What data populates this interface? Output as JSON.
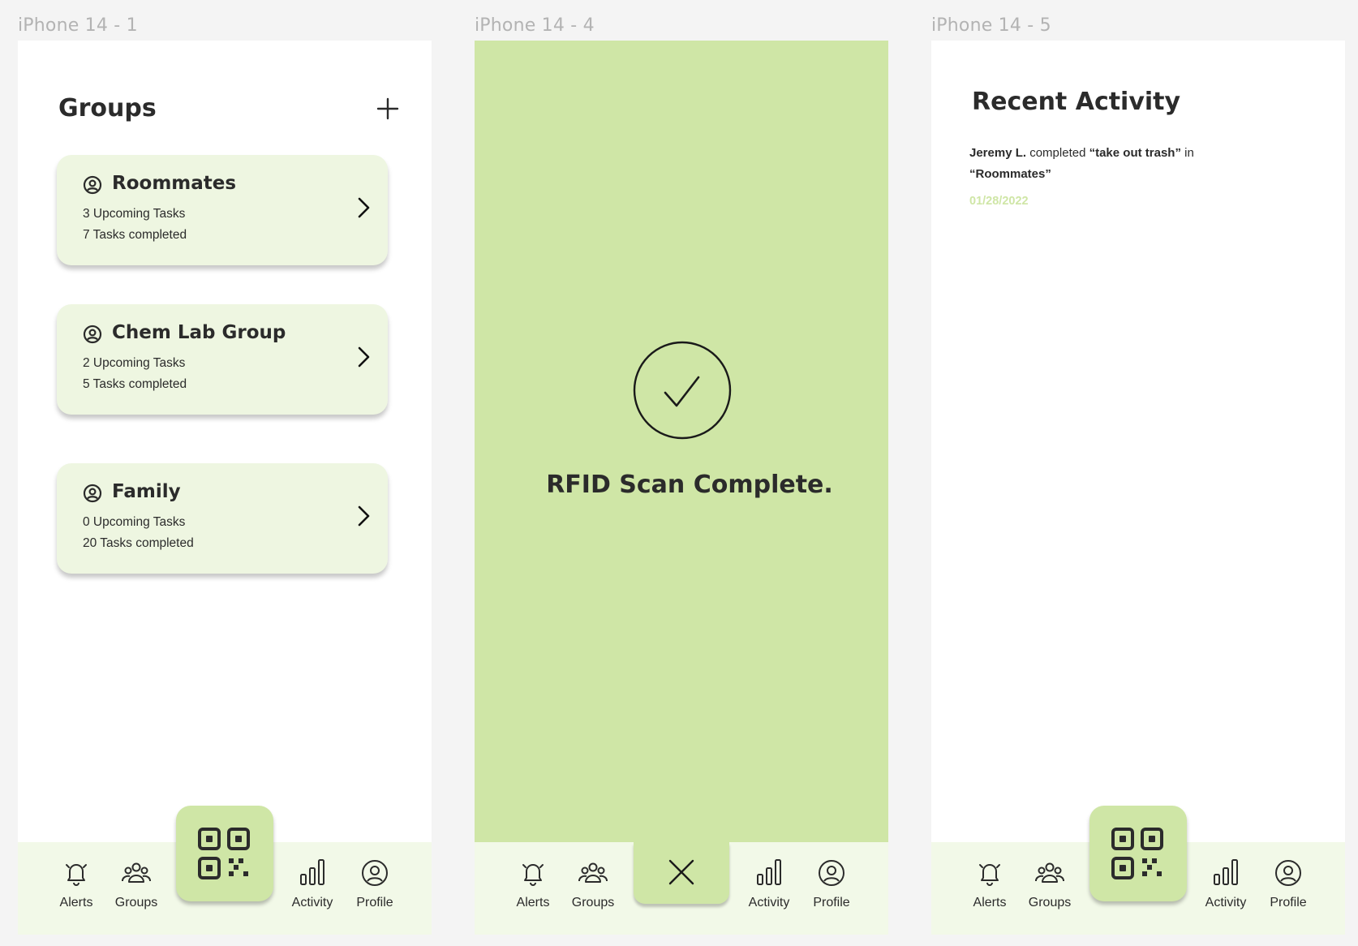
{
  "frames": {
    "frame1_label": "iPhone 14 - 1",
    "frame2_label": "iPhone 14 - 4",
    "frame3_label": "iPhone 14 - 5"
  },
  "groups_screen": {
    "title": "Groups",
    "add_icon": "plus-icon",
    "groups": [
      {
        "name": "Roommates",
        "upcoming": "3 Upcoming Tasks",
        "completed": "7 Tasks completed"
      },
      {
        "name": "Chem Lab Group",
        "upcoming": "2 Upcoming Tasks",
        "completed": "5 Tasks completed"
      },
      {
        "name": "Family",
        "upcoming": "0 Upcoming Tasks",
        "completed": "20 Tasks completed"
      }
    ]
  },
  "rfid_screen": {
    "message": "RFID Scan Complete.",
    "icon": "check-circle-icon",
    "close_icon": "close-icon"
  },
  "activity_screen": {
    "title": "Recent Activity",
    "entries": [
      {
        "user": "Jeremy L.",
        "verb": " completed ",
        "task": "“take out trash”",
        "preposition": " in",
        "group": "“Roommates”",
        "date": "01/28/2022"
      }
    ]
  },
  "nav": {
    "alerts": "Alerts",
    "groups": "Groups",
    "activity": "Activity",
    "profile": "Profile",
    "scan_icon": "qr-code-icon"
  },
  "colors": {
    "accent": "#cfe6a6",
    "card_bg": "#eef6e1",
    "nav_bg": "#f2f9e8",
    "text": "#2b2b2b",
    "label_gray": "#b3b3b3"
  }
}
